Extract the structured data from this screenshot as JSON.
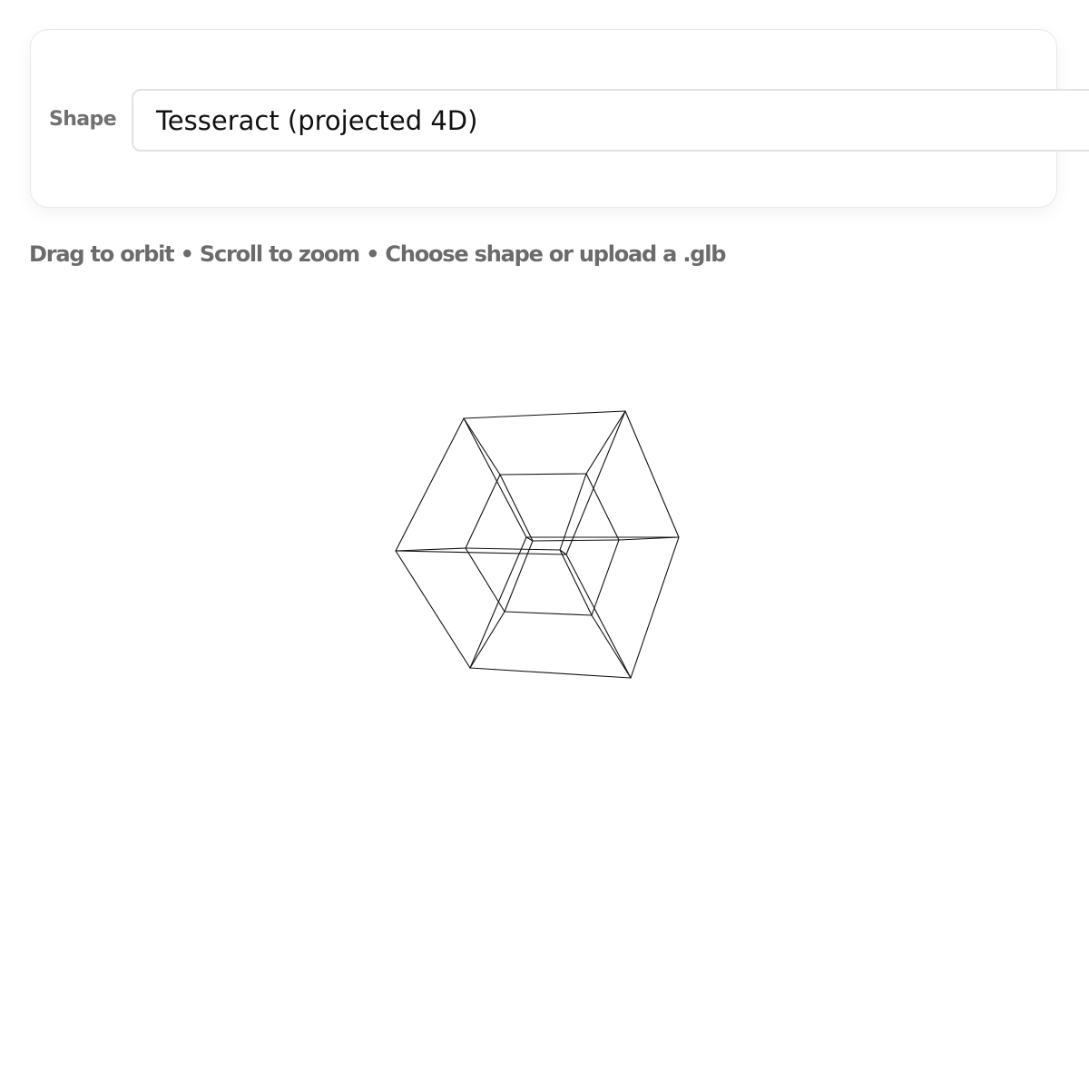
{
  "controls": {
    "shape_label": "Shape",
    "shape_selected": "Tesseract (projected 4D)"
  },
  "hint": "Drag to orbit • Scroll to zoom • Choose shape or upload a .glb",
  "viewer": {
    "model": "tesseract wireframe",
    "line_color": "#111111",
    "background": "#ffffff"
  }
}
